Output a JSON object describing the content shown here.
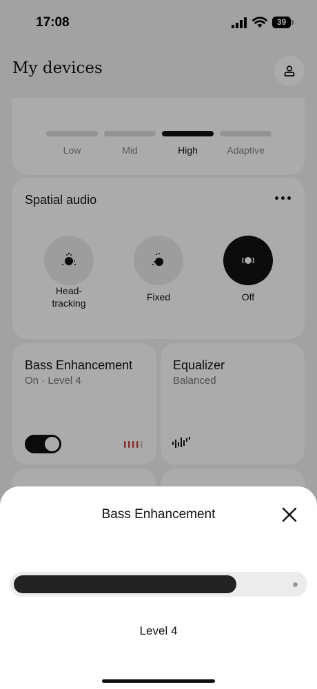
{
  "status_bar": {
    "time": "17:08",
    "battery": "39"
  },
  "header": {
    "title": "My devices",
    "profile_icon": "person-icon"
  },
  "quality_card": {
    "options": [
      "Low",
      "Mid",
      "High",
      "Adaptive"
    ],
    "selected": "High"
  },
  "spatial_audio": {
    "title": "Spatial audio",
    "menu_icon": "more-dots-icon",
    "options": [
      {
        "line1": "Head-",
        "line2": "tracking",
        "icon": "head-tracking-icon"
      },
      {
        "line1": "Fixed",
        "line2": "",
        "icon": "fixed-audio-icon"
      },
      {
        "line1": "Off",
        "line2": "",
        "icon": "spatial-off-icon"
      }
    ],
    "selected": "Off"
  },
  "bass_card": {
    "title": "Bass Enhancement",
    "subtitle": "On · Level 4",
    "enabled": true,
    "level_icon": "bass-level-icon"
  },
  "equalizer_card": {
    "title": "Equalizer",
    "subtitle": "Balanced",
    "icon": "waveform-icon"
  },
  "sheet": {
    "title": "Bass Enhancement",
    "close_icon": "close-icon",
    "slider_value_fraction": 0.77,
    "level_label": "Level 4"
  },
  "colors": {
    "background": "#f2f2f2",
    "card": "#ffffff",
    "accent_dark": "#111111",
    "bass_bars": "#d23b3b"
  }
}
